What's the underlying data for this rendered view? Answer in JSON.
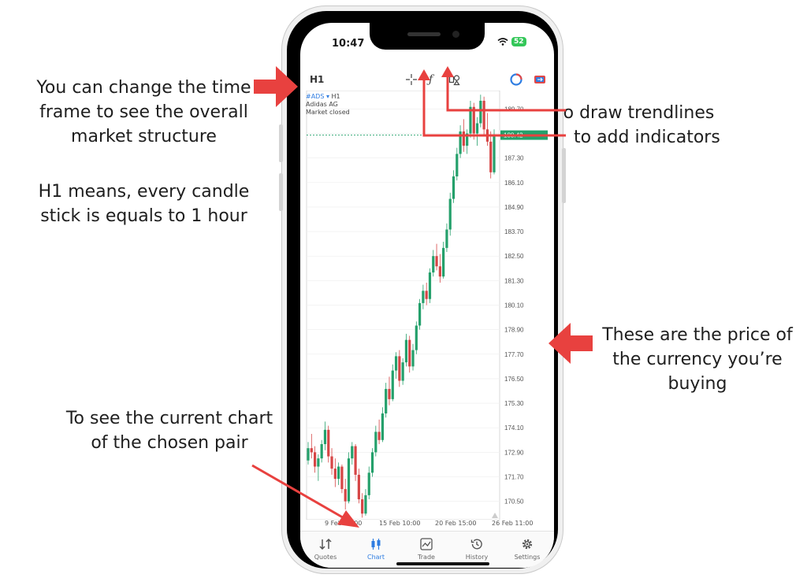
{
  "annotations": {
    "timeframe": [
      "You can change the time",
      "frame to see the overall",
      "market structure"
    ],
    "h1_meaning": [
      "H1 means, every candle",
      "stick is equals to 1 hour"
    ],
    "tools": [
      "to draw trendlines",
      "to add indicators"
    ],
    "price": [
      "These are the price of",
      "the currency you’re",
      "buying"
    ],
    "chart_tab": [
      "To see the current chart",
      "of the chosen pair"
    ]
  },
  "status_bar": {
    "time": "10:47",
    "battery": "52"
  },
  "toolbar": {
    "timeframe": "H1",
    "crosshair_icon": "crosshair-icon",
    "indicators_icon": "function-icon",
    "objects_icon": "draw-objects-icon"
  },
  "chart_info": {
    "symbol": "#ADS",
    "timeframe": "H1",
    "name": "Adidas AG",
    "status": "Market closed"
  },
  "chart_data": {
    "type": "candlestick",
    "price_axis": [
      "189.70",
      "188.50",
      "187.30",
      "186.10",
      "184.90",
      "183.70",
      "182.50",
      "181.30",
      "180.10",
      "178.90",
      "177.70",
      "176.50",
      "175.30",
      "174.10",
      "172.90",
      "171.70",
      "170.50"
    ],
    "current_price": "188.42",
    "ylim": [
      169.6,
      190.6
    ],
    "x_axis": [
      "9 Feb 14:00",
      "15 Feb 10:00",
      "20 Feb 15:00",
      "26 Feb 11:00"
    ],
    "candles": [
      [
        172.5,
        173.4,
        172.3,
        173.1
      ],
      [
        173.1,
        173.8,
        172.6,
        172.9
      ],
      [
        172.9,
        173.2,
        171.9,
        172.2
      ],
      [
        172.2,
        172.8,
        171.5,
        172.6
      ],
      [
        172.6,
        173.5,
        172.4,
        173.3
      ],
      [
        173.3,
        174.4,
        173.0,
        174.0
      ],
      [
        174.0,
        174.2,
        172.4,
        172.7
      ],
      [
        172.7,
        173.1,
        171.8,
        172.1
      ],
      [
        172.1,
        172.6,
        171.2,
        171.6
      ],
      [
        171.6,
        172.4,
        171.3,
        172.2
      ],
      [
        172.2,
        172.3,
        170.9,
        171.1
      ],
      [
        171.1,
        171.6,
        170.1,
        170.5
      ],
      [
        170.5,
        172.9,
        170.4,
        172.6
      ],
      [
        172.6,
        173.4,
        172.3,
        173.2
      ],
      [
        173.2,
        173.3,
        171.5,
        171.8
      ],
      [
        171.8,
        172.1,
        170.4,
        170.6
      ],
      [
        170.6,
        170.9,
        169.7,
        169.9
      ],
      [
        169.9,
        171.1,
        169.8,
        170.8
      ],
      [
        170.8,
        172.2,
        170.6,
        171.9
      ],
      [
        171.9,
        173.1,
        171.7,
        172.9
      ],
      [
        172.9,
        174.2,
        172.7,
        173.9
      ],
      [
        173.9,
        174.5,
        173.3,
        173.5
      ],
      [
        173.5,
        175.1,
        173.4,
        174.8
      ],
      [
        174.8,
        176.3,
        174.6,
        176.0
      ],
      [
        176.0,
        176.6,
        175.2,
        175.5
      ],
      [
        175.5,
        177.2,
        175.4,
        176.9
      ],
      [
        176.9,
        177.8,
        176.5,
        177.6
      ],
      [
        177.6,
        177.9,
        176.1,
        176.4
      ],
      [
        176.4,
        177.5,
        176.2,
        177.3
      ],
      [
        177.3,
        178.7,
        177.1,
        178.4
      ],
      [
        178.4,
        178.6,
        176.8,
        177.1
      ],
      [
        177.1,
        178.2,
        176.9,
        177.9
      ],
      [
        177.9,
        179.3,
        177.7,
        179.1
      ],
      [
        179.1,
        180.4,
        178.9,
        180.2
      ],
      [
        180.2,
        181.1,
        179.9,
        180.8
      ],
      [
        180.8,
        181.2,
        180.1,
        180.4
      ],
      [
        180.4,
        181.9,
        180.2,
        181.7
      ],
      [
        181.7,
        182.8,
        181.5,
        182.5
      ],
      [
        182.5,
        183.1,
        181.8,
        182.0
      ],
      [
        182.0,
        182.6,
        181.2,
        181.5
      ],
      [
        181.5,
        183.2,
        181.4,
        182.9
      ],
      [
        182.9,
        184.1,
        182.7,
        183.8
      ],
      [
        183.8,
        185.6,
        183.5,
        185.3
      ],
      [
        185.3,
        186.7,
        185.1,
        186.4
      ],
      [
        186.4,
        187.8,
        186.2,
        187.5
      ],
      [
        187.5,
        188.9,
        187.3,
        188.6
      ],
      [
        188.6,
        189.2,
        187.6,
        187.9
      ],
      [
        187.9,
        188.7,
        187.5,
        188.5
      ],
      [
        188.5,
        190.1,
        188.3,
        189.8
      ],
      [
        189.8,
        190.0,
        188.2,
        188.5
      ],
      [
        188.5,
        189.3,
        187.9,
        189.0
      ],
      [
        189.0,
        190.4,
        188.8,
        190.1
      ],
      [
        190.1,
        190.3,
        188.4,
        188.7
      ],
      [
        188.7,
        189.5,
        187.9,
        188.1
      ],
      [
        188.1,
        188.6,
        186.3,
        186.6
      ],
      [
        186.6,
        188.7,
        186.5,
        188.4
      ]
    ]
  },
  "tabs": [
    {
      "label": "Quotes",
      "icon": "quotes-icon"
    },
    {
      "label": "Chart",
      "icon": "chart-icon"
    },
    {
      "label": "Trade",
      "icon": "trade-icon"
    },
    {
      "label": "History",
      "icon": "history-icon"
    },
    {
      "label": "Settings",
      "icon": "settings-icon"
    }
  ],
  "colors": {
    "bull": "#24a06b",
    "bear": "#d64545",
    "accent": "#2f7de1",
    "arrow": "#e8413f"
  }
}
